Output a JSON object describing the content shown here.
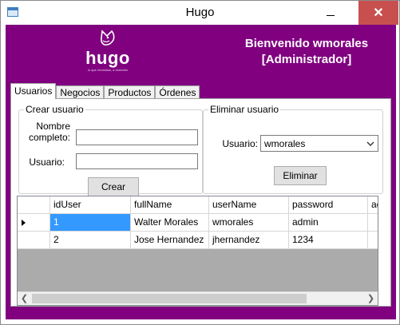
{
  "window": {
    "title": "Hugo",
    "close_glyph": "✕"
  },
  "header": {
    "logo_word": "hugo",
    "logo_tagline": "lo que necesitas, a domicilio",
    "welcome_line1": "Bienvenido wmorales",
    "welcome_line2": "[Administrador]",
    "brand_color": "#800080"
  },
  "tabs": [
    {
      "label": "Usuarios",
      "active": true
    },
    {
      "label": "Negocios",
      "active": false
    },
    {
      "label": "Productos",
      "active": false
    },
    {
      "label": "Órdenes",
      "active": false
    }
  ],
  "create_user": {
    "legend": "Crear usuario",
    "full_name_label": "Nombre completo:",
    "full_name_value": "",
    "username_label": "Usuario:",
    "username_value": "",
    "submit_label": "Crear"
  },
  "delete_user": {
    "legend": "Eliminar usuario",
    "user_label": "Usuario:",
    "user_selected": "wmorales",
    "submit_label": "Eliminar"
  },
  "grid": {
    "columns": [
      "idUser",
      "fullName",
      "userName",
      "password",
      "ac"
    ],
    "rows": [
      [
        "1",
        "Walter Morales",
        "wmorales",
        "admin",
        ""
      ],
      [
        "2",
        "Jose Hernandez",
        "jhernandez",
        "1234",
        ""
      ]
    ],
    "selected_row": 0,
    "selected_color": "#3399ff"
  }
}
